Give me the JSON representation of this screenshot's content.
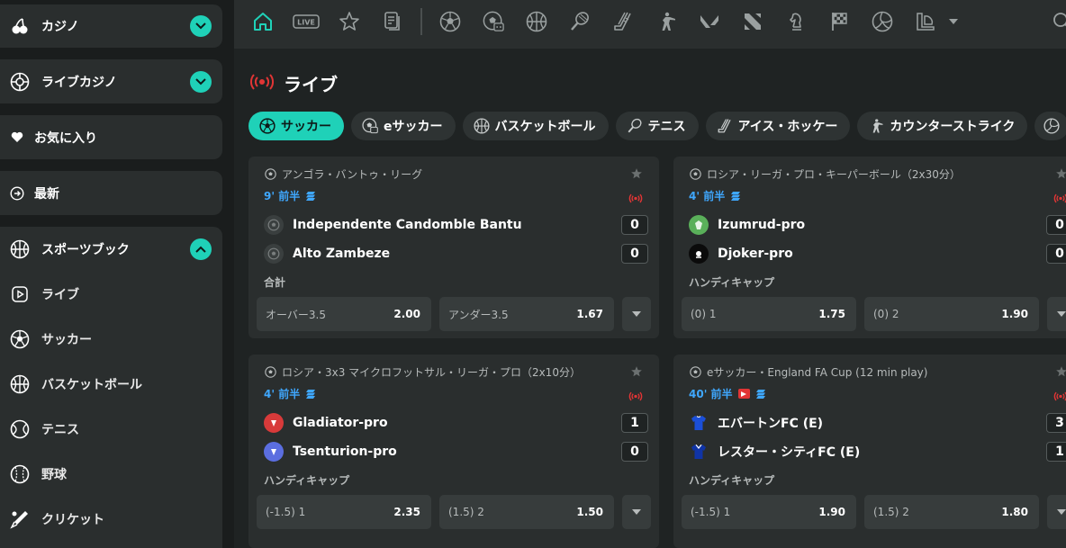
{
  "sidebar": {
    "casino": "カジノ",
    "live_casino": "ライブカジノ",
    "favorites": "お気に入り",
    "recent": "最新",
    "sportsbook": "スポーツブック",
    "items": [
      {
        "label": "ライブ",
        "icon": "play-icon"
      },
      {
        "label": "サッカー",
        "icon": "soccer-icon"
      },
      {
        "label": "バスケットボール",
        "icon": "basketball-icon"
      },
      {
        "label": "テニス",
        "icon": "tennis-icon"
      },
      {
        "label": "野球",
        "icon": "baseball-icon"
      },
      {
        "label": "クリケット",
        "icon": "cricket-icon"
      }
    ]
  },
  "topnav": {
    "live_badge": "LIVE",
    "icons": [
      "home-icon",
      "live-icon",
      "star-icon",
      "betslip-icon",
      "soccer-icon",
      "esoccer-icon",
      "basketball-icon",
      "tennis-icon",
      "hockey-icon",
      "counter-strike-icon",
      "valorant-icon",
      "dota-icon",
      "chess-icon",
      "racing-flag-icon",
      "volleyball-icon",
      "lol-icon",
      "chevron-down-icon",
      "search-icon"
    ]
  },
  "page": {
    "title": "ライブ",
    "accent": "#1fd1b8",
    "live_color": "#e23535",
    "time_color": "#3fa8ff"
  },
  "chips": [
    {
      "label": "サッカー",
      "active": true
    },
    {
      "label": "eサッカー",
      "active": false
    },
    {
      "label": "バスケットボール",
      "active": false
    },
    {
      "label": "テニス",
      "active": false
    },
    {
      "label": "アイス・ホッケー",
      "active": false
    },
    {
      "label": "カウンターストライク",
      "active": false
    }
  ],
  "cards": [
    {
      "league": "アンゴラ・バントゥ・リーグ",
      "time": "9' 前半",
      "team1": "Independente Candomble Bantu",
      "score1": "0",
      "team2": "Alto Zambeze",
      "score2": "0",
      "market": "合計",
      "odd1_label": "オーバー3.5",
      "odd1_value": "2.00",
      "odd2_label": "アンダー3.5",
      "odd2_value": "1.67"
    },
    {
      "league": "ロシア・リーガ・プロ・キーパーボール（2x30分）",
      "time": "4' 前半",
      "team1": "Izumrud-pro",
      "score1": "0",
      "team2": "Djoker-pro",
      "score2": "0",
      "market": "ハンディキャップ",
      "odd1_label": "(0) 1",
      "odd1_value": "1.75",
      "odd2_label": "(0) 2",
      "odd2_value": "1.90"
    },
    {
      "league": "ロシア・3x3 マイクロフットサル・リーガ・プロ（2x10分）",
      "time": "4' 前半",
      "team1": "Gladiator-pro",
      "score1": "1",
      "team2": "Tsenturion-pro",
      "score2": "0",
      "market": "ハンディキャップ",
      "odd1_label": "(-1.5) 1",
      "odd1_value": "2.35",
      "odd2_label": "(1.5) 2",
      "odd2_value": "1.50"
    },
    {
      "league": "eサッカー・England FA Cup (12 min play)",
      "time": "40' 前半",
      "team1": "エバートンFC (E)",
      "score1": "3",
      "team2": "レスター・シティFC (E)",
      "score2": "1",
      "market": "ハンディキャップ",
      "odd1_label": "(-1.5) 1",
      "odd1_value": "1.90",
      "odd2_label": "(1.5) 2",
      "odd2_value": "1.80"
    }
  ]
}
